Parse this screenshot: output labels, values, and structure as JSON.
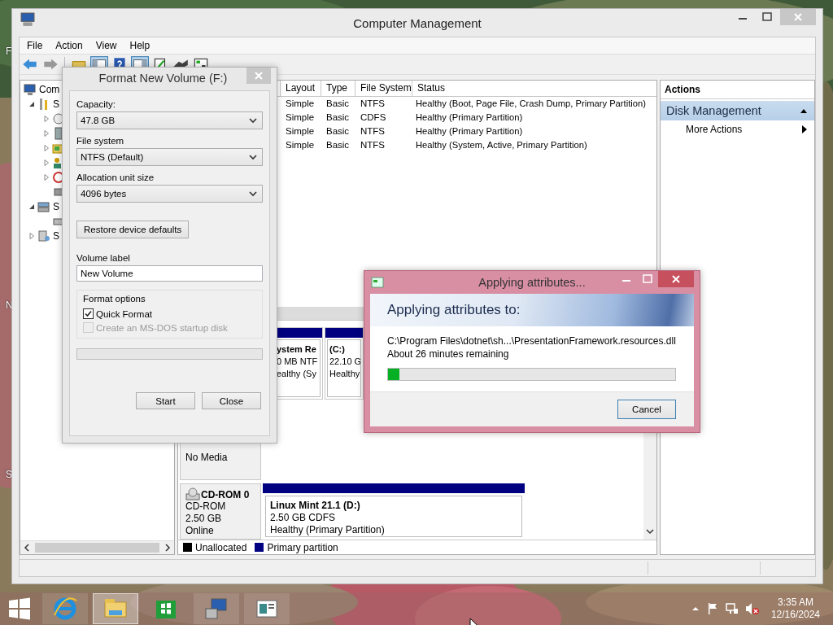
{
  "desktop": {
    "edge_labels": [
      "F",
      "N",
      "S"
    ]
  },
  "window": {
    "title": "Computer Management"
  },
  "menu": [
    "File",
    "Action",
    "View",
    "Help"
  ],
  "toolbar": [
    {
      "kind": "back",
      "pressed": false
    },
    {
      "kind": "forward",
      "pressed": false
    },
    {
      "kind": "separator"
    },
    {
      "kind": "up",
      "pressed": false
    },
    {
      "kind": "tree",
      "pressed": true
    },
    {
      "kind": "help",
      "pressed": false
    },
    {
      "kind": "pane",
      "pressed": true
    },
    {
      "kind": "export",
      "pressed": false
    },
    {
      "kind": "connect",
      "pressed": false
    },
    {
      "kind": "properties",
      "pressed": false
    }
  ],
  "tree": {
    "items": [
      {
        "label": "Com",
        "kind": "computer",
        "children": [
          {
            "label": "S",
            "kind": "tools",
            "expanded": true,
            "children": [
              {
                "kind": "clock",
                "expanded": false
              },
              {
                "kind": "viewer",
                "expanded": false
              },
              {
                "kind": "folder",
                "expanded": false
              },
              {
                "kind": "users",
                "expanded": false
              },
              {
                "kind": "gauge",
                "expanded": false
              },
              {
                "kind": "device"
              }
            ]
          },
          {
            "label": "S",
            "kind": "storage",
            "expanded": true,
            "children": [
              {
                "kind": "disk"
              }
            ]
          },
          {
            "label": "S",
            "kind": "services",
            "expanded": false
          }
        ]
      }
    ]
  },
  "list": {
    "columns": [
      "Layout",
      "Type",
      "File System",
      "Status"
    ],
    "rows": [
      [
        "Simple",
        "Basic",
        "NTFS",
        "Healthy (Boot, Page File, Crash Dump, Primary Partition)"
      ],
      [
        "Simple",
        "Basic",
        "CDFS",
        "Healthy (Primary Partition)"
      ],
      [
        "Simple",
        "Basic",
        "NTFS",
        "Healthy (Primary Partition)"
      ],
      [
        "Simple",
        "Basic",
        "NTFS",
        "Healthy (System, Active, Primary Partition)"
      ]
    ]
  },
  "disks": [
    {
      "kind": "partitions",
      "partitions": [
        {
          "lines": [
            "ystem Re",
            "0 MB NTF",
            "ealthy (Sy"
          ]
        },
        {
          "lines": [
            "(C:)",
            "22.10 G",
            "Healthy"
          ]
        }
      ]
    },
    {
      "kind": "empty",
      "status": "No Media"
    },
    {
      "kind": "disk",
      "name": "CD-ROM 0",
      "info": [
        "CD-ROM",
        "2.50 GB",
        "Online"
      ],
      "partitions": [
        {
          "lines": [
            "Linux Mint 21.1  (D:)",
            "2.50 GB CDFS",
            "Healthy (Primary Partition)"
          ]
        }
      ]
    }
  ],
  "legend": [
    {
      "label": "Unallocated",
      "color": "#000000"
    },
    {
      "label": "Primary partition",
      "color": "#000080"
    }
  ],
  "actions": {
    "title": "Actions",
    "section": {
      "label": "Disk Management",
      "expanded": true
    },
    "items": [
      "More Actions"
    ]
  },
  "format_dialog": {
    "title": "Format New Volume (F:)",
    "fields": [
      {
        "label": "Capacity:",
        "value": "47.8 GB"
      },
      {
        "label": "File system",
        "value": "NTFS (Default)"
      },
      {
        "label": "Allocation unit size",
        "value": "4096 bytes"
      }
    ],
    "restore_button": "Restore device defaults",
    "volume_label": {
      "label": "Volume label",
      "value": "New Volume"
    },
    "options": {
      "title": "Format options",
      "checks": [
        {
          "label": "Quick Format",
          "checked": true,
          "disabled": false
        },
        {
          "label": "Create an MS-DOS startup disk",
          "checked": false,
          "disabled": true
        }
      ]
    },
    "progress": {
      "level": 0
    },
    "buttons": [
      "Start",
      "Close"
    ]
  },
  "apply_dialog": {
    "title": "Applying attributes...",
    "heading": "Applying attributes to:",
    "path": "C:\\Program Files\\dotnet\\sh...\\PresentationFramework.resources.dll",
    "remaining": "About 26 minutes remaining",
    "progress": {
      "level": 0.04
    },
    "buttons": [
      "Cancel"
    ]
  },
  "taskbar": {
    "apps": [
      {
        "kind": "browser",
        "selected": false
      },
      {
        "kind": "explorer",
        "selected": true
      },
      {
        "kind": "store",
        "selected": false
      },
      {
        "kind": "management",
        "selected": false
      },
      {
        "kind": "document",
        "selected": false
      }
    ],
    "volume_muted": true,
    "time": "3:35 AM",
    "date": "12/16/2024"
  }
}
